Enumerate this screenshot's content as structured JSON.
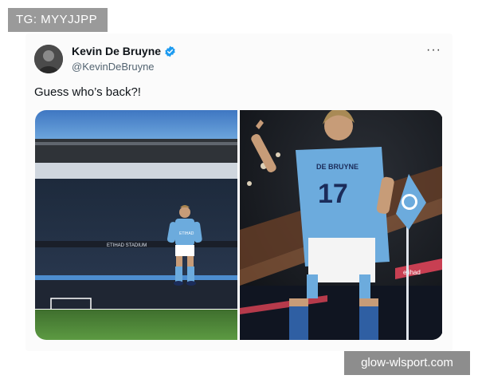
{
  "overlay": {
    "tag": "TG: MYYJJPP",
    "watermark": "glow-wlsport.com"
  },
  "tweet": {
    "author_name": "Kevin De Bruyne",
    "handle": "@KevinDeBruyne",
    "text": "Guess who’s back?!",
    "more_label": "···",
    "verified_color": "#1d9bf0"
  },
  "images": {
    "left": {
      "stadium_text": "ETIHAD STADIUM",
      "shirt_text": "ETIHAD"
    },
    "right": {
      "shirt_name": "DE BRUYNE",
      "shirt_number": "17",
      "board_text": "etihad"
    }
  },
  "colors": {
    "city_blue": "#6cabdd",
    "pitch_green": "#4e8a3a"
  }
}
